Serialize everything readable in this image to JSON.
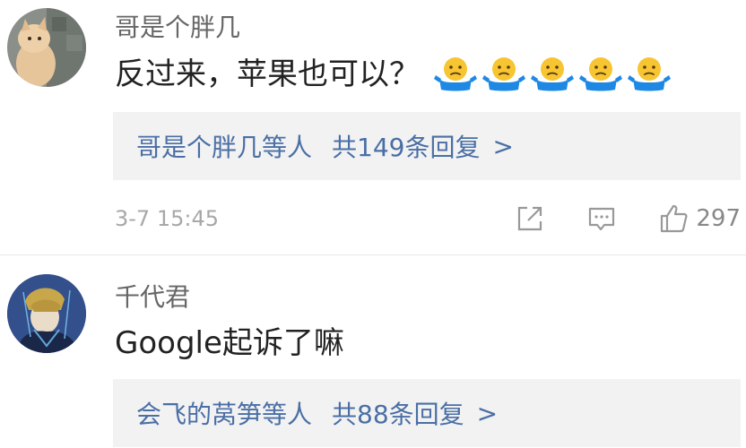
{
  "comments": [
    {
      "username": "哥是个胖几",
      "content": "反过来，苹果也可以？",
      "emoji": "shrug-emoji",
      "emoji_count": 5,
      "replies": {
        "names": "哥是个胖几等人",
        "count_text": "共149条回复",
        "chevron": ">"
      },
      "timestamp": "3-7 15:45",
      "likes": "297"
    },
    {
      "username": "千代君",
      "content": "Google起诉了嘛",
      "replies": {
        "names": "会飞的莴笋等人",
        "count_text": "共88条回复",
        "chevron": ">"
      }
    }
  ],
  "colors": {
    "link": "#4a6fa5",
    "reply_bg": "#f2f2f2",
    "meta": "#a8a8a8",
    "emoji_yellow": "#f7c531",
    "emoji_blue": "#1e88e5"
  }
}
